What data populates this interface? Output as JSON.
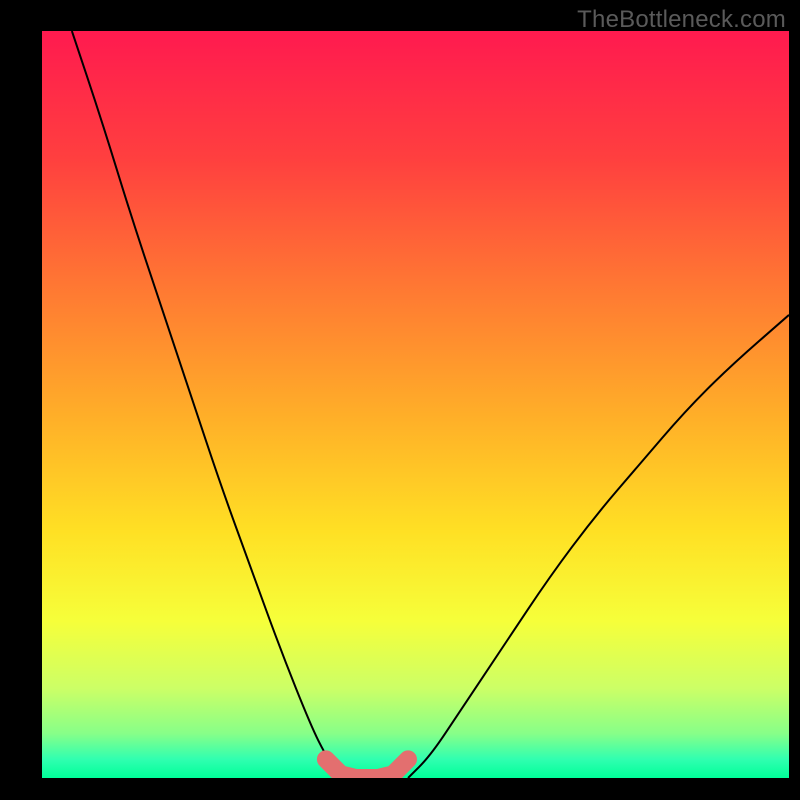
{
  "watermark": "TheBottleneck.com",
  "chart_data": {
    "type": "line",
    "title": "",
    "xlabel": "",
    "ylabel": "",
    "xlim": [
      0,
      100
    ],
    "ylim": [
      0,
      100
    ],
    "series": [
      {
        "name": "black-curve-left",
        "x": [
          4,
          8,
          12,
          16,
          20,
          24,
          28,
          32,
          36,
          38,
          40
        ],
        "y": [
          100,
          88,
          75,
          63,
          51,
          39,
          28,
          17,
          7,
          3,
          0
        ]
      },
      {
        "name": "black-curve-right",
        "x": [
          49,
          52,
          56,
          62,
          68,
          74,
          80,
          86,
          92,
          100
        ],
        "y": [
          0,
          3,
          9,
          18,
          27,
          35,
          42,
          49,
          55,
          62
        ]
      },
      {
        "name": "pink-highlight",
        "x": [
          38,
          40,
          42,
          45,
          47,
          49
        ],
        "y": [
          2.5,
          0.5,
          0,
          0,
          0.5,
          2.5
        ]
      }
    ],
    "gradient_stops": [
      {
        "offset": 0.0,
        "color": "#ff1a4f"
      },
      {
        "offset": 0.17,
        "color": "#ff3f3f"
      },
      {
        "offset": 0.34,
        "color": "#ff7733"
      },
      {
        "offset": 0.52,
        "color": "#ffb028"
      },
      {
        "offset": 0.67,
        "color": "#ffe024"
      },
      {
        "offset": 0.79,
        "color": "#f6ff3a"
      },
      {
        "offset": 0.88,
        "color": "#ccff66"
      },
      {
        "offset": 0.94,
        "color": "#88ff88"
      },
      {
        "offset": 0.975,
        "color": "#30ffb0"
      },
      {
        "offset": 1.0,
        "color": "#00ff99"
      }
    ]
  }
}
